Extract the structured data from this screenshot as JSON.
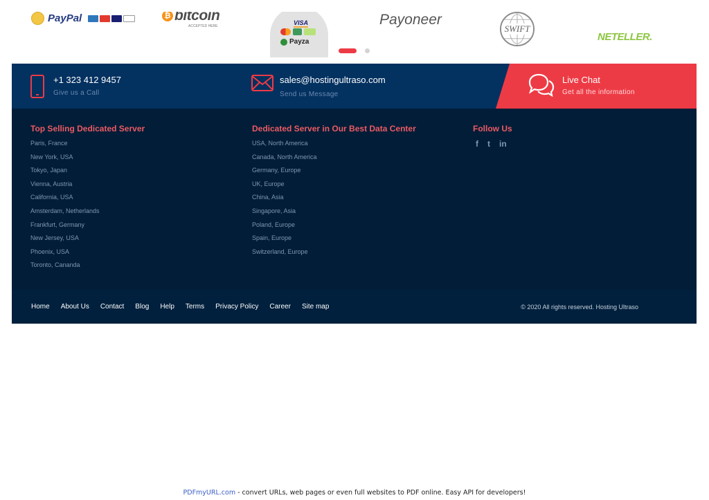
{
  "payment_logos": {
    "paypal": "PayPal",
    "bitcoin": "bitcoin",
    "bitcoin_sub": "ACCEPTED HERE",
    "payza_visa": "VISA",
    "payza": "Payza",
    "payoneer": "Payoneer",
    "swift": "SWIFT",
    "neteller": "NETELLER."
  },
  "contact": {
    "phone": "+1 323 412 9457",
    "phone_sub": "Give us a Call",
    "email": "sales@hostingultraso.com",
    "email_sub": "Send us Message",
    "chat": "Live Chat",
    "chat_sub": "Get all the information"
  },
  "footer": {
    "col1": {
      "title": "Top Selling Dedicated Server",
      "links": [
        "Paris, France",
        "New York, USA",
        "Tokyo, Japan",
        "Vienna, Austria",
        "California, USA",
        "Amsterdam, Netherlands",
        "Frankfurt, Germany",
        "New Jersey, USA",
        "Phoenix, USA",
        "Toronto, Cananda"
      ]
    },
    "col2": {
      "title": "Dedicated Server in Our Best Data Center",
      "links": [
        "USA, North America",
        "Canada, North America",
        "Germany, Europe",
        "UK, Europe",
        "China, Asia",
        "Singapore, Asia",
        "Poland, Europe",
        "Spain, Europe",
        "Switzerland, Europe"
      ]
    },
    "col3": {
      "title": "Follow Us",
      "social": [
        "f",
        "t",
        "in"
      ]
    }
  },
  "bottom_nav": [
    "Home",
    "About Us",
    "Contact",
    "Blog",
    "Help",
    "Terms",
    "Privacy Policy",
    "Career",
    "Site map"
  ],
  "copyright": "© 2020 All rights reserved. Hosting Ultraso",
  "pdf_note": {
    "link": "PDFmyURL.com",
    "text": " - convert URLs, web pages or even full websites to PDF online. Easy API for developers!"
  },
  "colors": {
    "accent": "#ed3b45",
    "contact_bar": "#033160",
    "footer_bg": "#011d38"
  }
}
